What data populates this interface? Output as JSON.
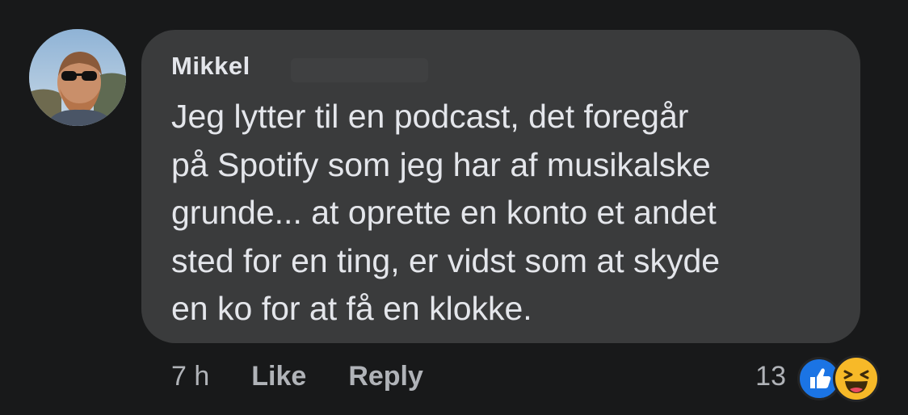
{
  "comment": {
    "author": "Mikkel",
    "text": "Jeg lytter til en podcast, det foregår\npå Spotify som jeg har af musikalske\ngrunde... at oprette en konto et andet\nsted for en ting, er vidst som at skyde\nen ko for at få en klokke.",
    "timestamp": "7 h",
    "like_label": "Like",
    "reply_label": "Reply",
    "reaction_count": "13",
    "reactions": [
      "like-icon",
      "haha-icon"
    ]
  },
  "colors": {
    "background": "#18191a",
    "bubble": "#3a3b3c",
    "text": "#e4e6eb",
    "secondary_text": "#b0b3b8",
    "like_blue": "#1b74e4",
    "haha_yellow": "#f7b928"
  }
}
